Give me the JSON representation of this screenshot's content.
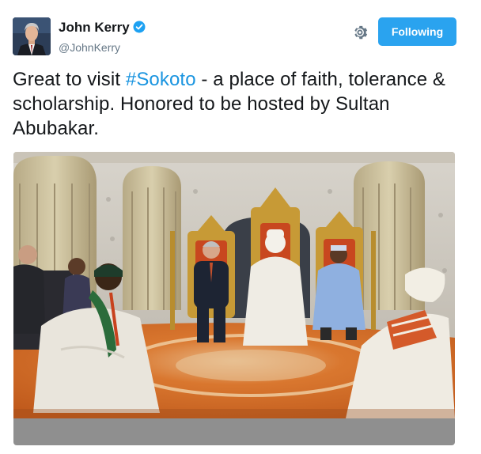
{
  "author": {
    "display_name": "John Kerry",
    "handle": "@JohnKerry",
    "verified": true,
    "avatar_icon": "profile-photo"
  },
  "actions": {
    "follow_label": "Following",
    "settings_icon": "gear-icon"
  },
  "tweet": {
    "text_before": "Great to visit ",
    "hashtag": "#Sokoto",
    "text_after": " - a place of faith, tolerance & scholarship. Honored to be hosted by Sultan Abubakar."
  },
  "media": {
    "type": "photo"
  },
  "colors": {
    "accent": "#1b95e0",
    "button": "#2aa3ef",
    "verified": "#1da1f2",
    "muted": "#657786"
  }
}
